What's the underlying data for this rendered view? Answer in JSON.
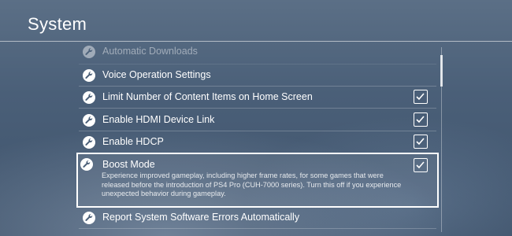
{
  "header": {
    "title": "System"
  },
  "settings": {
    "items": [
      {
        "label": "Automatic Downloads",
        "checkable": false,
        "faded": true
      },
      {
        "label": "Voice Operation Settings",
        "checkable": false
      },
      {
        "label": "Limit Number of Content Items on Home Screen",
        "checkable": true,
        "checked": true
      },
      {
        "label": "Enable HDMI Device Link",
        "checkable": true,
        "checked": true
      },
      {
        "label": "Enable HDCP",
        "checkable": true,
        "checked": true
      },
      {
        "label": "Boost Mode",
        "checkable": true,
        "checked": true,
        "selected": true,
        "description": "Experience improved gameplay, including higher frame rates, for some games that were released before the introduction of PS4 Pro (CUH-7000 series). Turn this off if you experience unexpected behavior during gameplay."
      },
      {
        "label": "Report System Software Errors Automatically",
        "checkable": false
      }
    ]
  },
  "icons": {
    "item": "wrench-icon",
    "check": "checkmark-icon"
  },
  "colors": {
    "background": "#4a5f78",
    "text": "#ffffff",
    "highlight_border": "#ffffff"
  }
}
